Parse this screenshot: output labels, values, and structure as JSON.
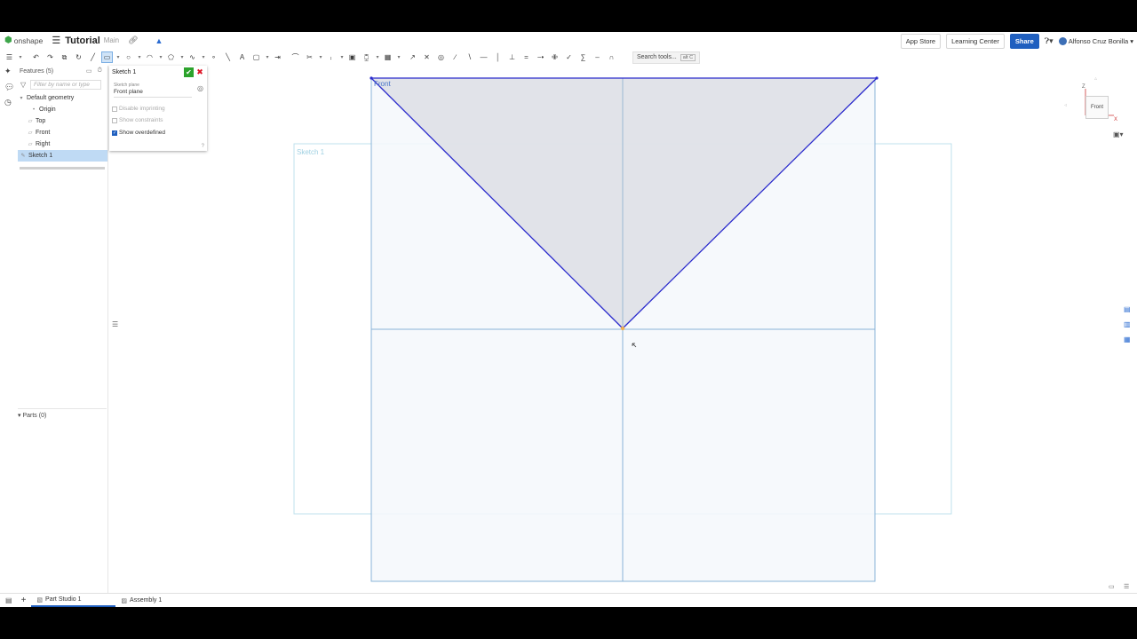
{
  "header": {
    "logo": "onshape",
    "doc_title": "Tutorial",
    "branch": "Main",
    "app_store": "App Store",
    "learning_center": "Learning Center",
    "share": "Share",
    "user": "Alfonso Cruz Bonilla"
  },
  "toolbar": {
    "search_tools": "Search tools...",
    "search_shortcut": "alt C"
  },
  "tree": {
    "features_label": "Features (5)",
    "filter_placeholder": "Filter by name or type",
    "default_geometry": "Default geometry",
    "items": [
      "Origin",
      "Top",
      "Front",
      "Right"
    ],
    "sketch": "Sketch 1",
    "parts": "Parts (0)"
  },
  "dialog": {
    "title": "Sketch 1",
    "plane_label": "Sketch plane",
    "plane_value": "Front plane",
    "disable_imprinting": "Disable imprinting",
    "show_constraints": "Show constraints",
    "show_overdefined": "Show overdefined",
    "show_overdefined_checked": true
  },
  "viewport": {
    "plane_label": "Front",
    "sketch_label": "Sketch 1",
    "cube_face": "Front",
    "axis_z": "Z",
    "axis_x": "X"
  },
  "tabs": [
    {
      "label": "Part Studio 1",
      "active": true
    },
    {
      "label": "Assembly 1",
      "active": false
    }
  ],
  "colors": {
    "sketch_line": "#2a2acc",
    "region_fill": "#dfe2e8",
    "plane_fill": "#f4f8fb",
    "plane_border": "#8ab4d8",
    "sketch_plane_border": "#bfe2ee",
    "accent": "#1f5fbf"
  }
}
